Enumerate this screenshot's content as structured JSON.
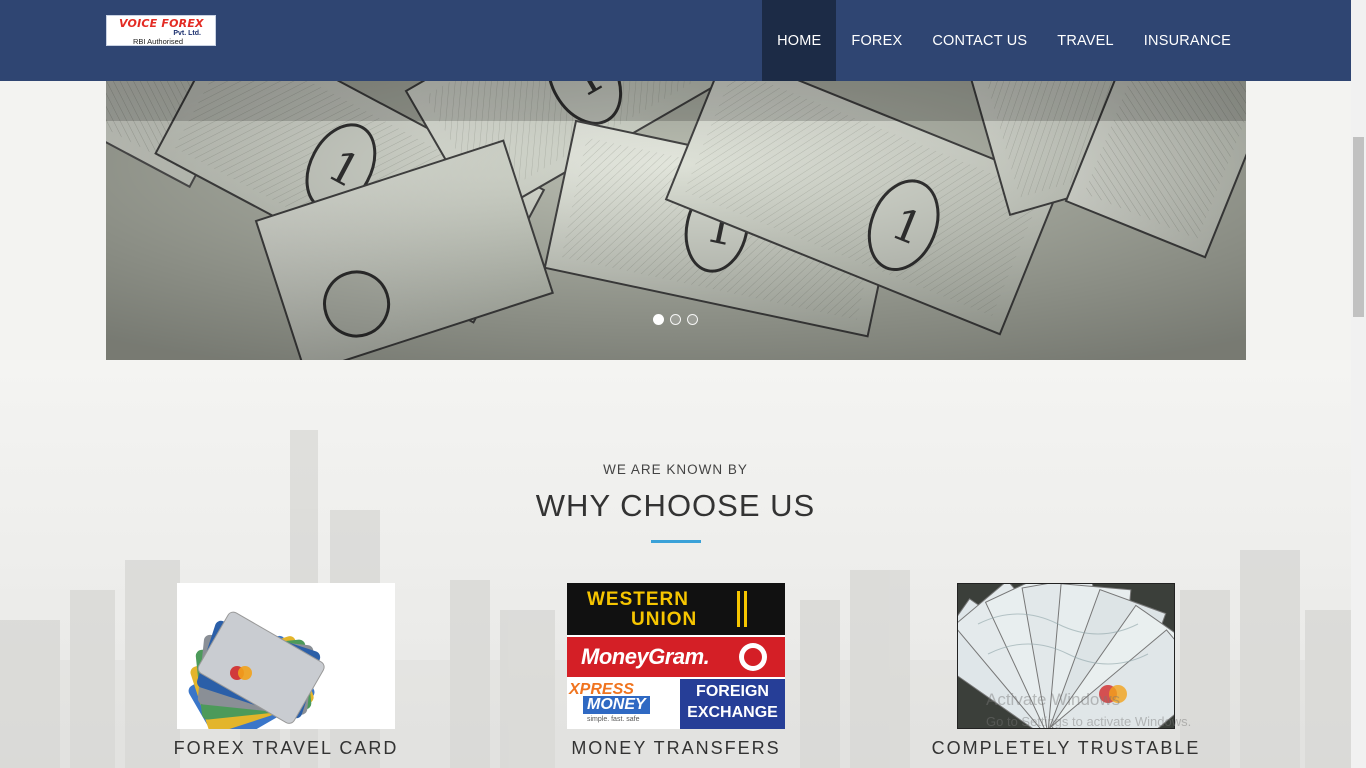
{
  "brand": {
    "name": "VOICE FOREX",
    "suffix": "Pvt. Ltd.",
    "tagline": "RBI Authorised"
  },
  "nav": {
    "items": [
      {
        "label": "HOME",
        "active": true
      },
      {
        "label": "FOREX",
        "active": false
      },
      {
        "label": "CONTACT US",
        "active": false
      },
      {
        "label": "TRAVEL",
        "active": false
      },
      {
        "label": "INSURANCE",
        "active": false
      }
    ]
  },
  "carousel": {
    "slide_count": 3,
    "active_index": 0,
    "note_value": "1"
  },
  "section": {
    "eyebrow": "WE ARE KNOWN BY",
    "title": "WHY CHOOSE US",
    "features": [
      {
        "label": "FOREX TRAVEL CARD"
      },
      {
        "label": "MONEY TRANSFERS",
        "logos": {
          "wu_top": "WESTERN",
          "wu_bottom": "UNION",
          "moneygram": "MoneyGram.",
          "xpress_top": "XPRESS",
          "xpress_bottom": "MONEY",
          "xpress_tag": "simple. fast. safe",
          "fx_top": "FOREIGN",
          "fx_bottom": "EXCHANGE"
        }
      },
      {
        "label": "COMPLETELY TRUSTABLE"
      }
    ]
  },
  "watermark": {
    "line1": "Activate Windows",
    "line2": "Go to Settings to activate Windows."
  },
  "colors": {
    "navbar": "#2f4572",
    "nav_active": "#1c2b46",
    "accent": "#3aa1d8",
    "logo_red": "#e32b23"
  }
}
